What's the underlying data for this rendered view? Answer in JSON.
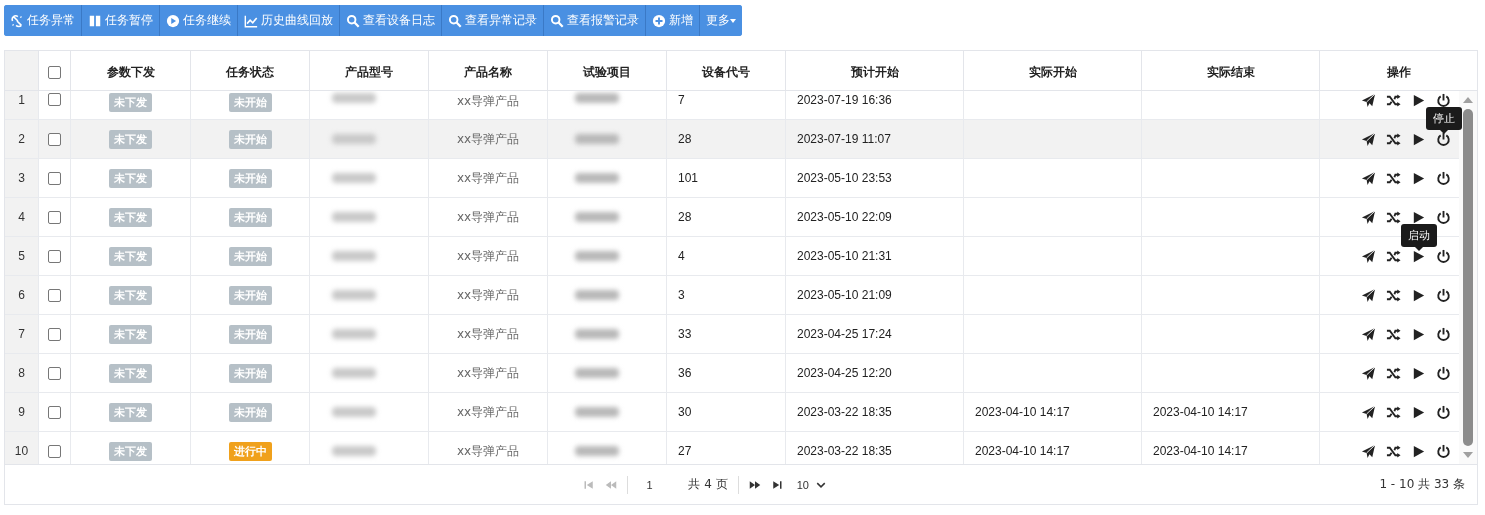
{
  "toolbar": [
    {
      "kind": "alert",
      "label": "任务异常"
    },
    {
      "kind": "pause",
      "label": "任务暂停"
    },
    {
      "kind": "play",
      "label": "任务继续"
    },
    {
      "kind": "chart",
      "label": "历史曲线回放"
    },
    {
      "kind": "search",
      "label": "查看设备日志"
    },
    {
      "kind": "search",
      "label": "查看异常记录"
    },
    {
      "kind": "search",
      "label": "查看报警记录"
    },
    {
      "kind": "add",
      "label": "新增"
    },
    {
      "kind": "more",
      "label": "更多"
    }
  ],
  "table": {
    "header_checked": false,
    "columns": [
      "参数下发",
      "任务状态",
      "产品型号",
      "产品名称",
      "试验项目",
      "设备代号",
      "预计开始",
      "实际开始",
      "实际结束",
      "操作"
    ],
    "actions": [
      {
        "kind": "send"
      },
      {
        "kind": "shuffle"
      },
      {
        "kind": "play"
      },
      {
        "kind": "power"
      }
    ],
    "rows": [
      {
        "index": "1",
        "checked": false,
        "partial": true,
        "highlighted": false,
        "dispatch": {
          "label": "未下发",
          "color": "#b6c0c7"
        },
        "status": {
          "label": "未开始",
          "color": "#b6c0c7"
        },
        "model_redacted": true,
        "name": "xx导弹产品",
        "test_redacted": true,
        "device": "7",
        "planned_start": "2023-07-19 16:36"
      },
      {
        "index": "2",
        "checked": false,
        "highlighted": true,
        "dispatch": {
          "label": "未下发",
          "color": "#b6c0c7"
        },
        "status": {
          "label": "未开始",
          "color": "#b6c0c7"
        },
        "model_redacted": true,
        "name": "xx导弹产品",
        "test_redacted": true,
        "device": "28",
        "planned_start": "2023-07-19 11:07",
        "tooltips": {
          "power": "停止"
        }
      },
      {
        "index": "3",
        "checked": false,
        "highlighted": false,
        "dispatch": {
          "label": "未下发",
          "color": "#b6c0c7"
        },
        "status": {
          "label": "未开始",
          "color": "#b6c0c7"
        },
        "model_redacted": true,
        "name": "xx导弹产品",
        "test_redacted": true,
        "device": "101",
        "planned_start": "2023-05-10 23:53"
      },
      {
        "index": "4",
        "checked": false,
        "highlighted": false,
        "dispatch": {
          "label": "未下发",
          "color": "#b6c0c7"
        },
        "status": {
          "label": "未开始",
          "color": "#b6c0c7"
        },
        "model_redacted": true,
        "name": "xx导弹产品",
        "test_redacted": true,
        "device": "28",
        "planned_start": "2023-05-10 22:09"
      },
      {
        "index": "5",
        "checked": false,
        "highlighted": false,
        "dispatch": {
          "label": "未下发",
          "color": "#b6c0c7"
        },
        "status": {
          "label": "未开始",
          "color": "#b6c0c7"
        },
        "model_redacted": true,
        "name": "xx导弹产品",
        "test_redacted": true,
        "device": "4",
        "planned_start": "2023-05-10 21:31",
        "tooltips": {
          "play": "启动"
        }
      },
      {
        "index": "6",
        "checked": false,
        "highlighted": false,
        "dispatch": {
          "label": "未下发",
          "color": "#b6c0c7"
        },
        "status": {
          "label": "未开始",
          "color": "#b6c0c7"
        },
        "model_redacted": true,
        "name": "xx导弹产品",
        "test_redacted": true,
        "device": "3",
        "planned_start": "2023-05-10 21:09"
      },
      {
        "index": "7",
        "checked": false,
        "highlighted": false,
        "dispatch": {
          "label": "未下发",
          "color": "#b6c0c7"
        },
        "status": {
          "label": "未开始",
          "color": "#b6c0c7"
        },
        "model_redacted": true,
        "name": "xx导弹产品",
        "test_redacted": true,
        "device": "33",
        "planned_start": "2023-04-25 17:24"
      },
      {
        "index": "8",
        "checked": false,
        "highlighted": false,
        "dispatch": {
          "label": "未下发",
          "color": "#b6c0c7"
        },
        "status": {
          "label": "未开始",
          "color": "#b6c0c7"
        },
        "model_redacted": true,
        "name": "xx导弹产品",
        "test_redacted": true,
        "device": "36",
        "planned_start": "2023-04-25 12:20"
      },
      {
        "index": "9",
        "checked": false,
        "highlighted": false,
        "dispatch": {
          "label": "未下发",
          "color": "#b6c0c7"
        },
        "status": {
          "label": "未开始",
          "color": "#b6c0c7"
        },
        "model_redacted": true,
        "name": "xx导弹产品",
        "test_redacted": true,
        "device": "30",
        "planned_start": "2023-03-22 18:35",
        "actual_start": "2023-04-10 14:17",
        "actual_end": "2023-04-10 14:17"
      },
      {
        "index": "10",
        "checked": false,
        "highlighted": false,
        "dispatch": {
          "label": "未下发",
          "color": "#b6c0c7"
        },
        "status": {
          "label": "进行中",
          "color": "#f0a11c"
        },
        "model_redacted": true,
        "name": "xx导弹产品",
        "test_redacted": true,
        "device": "27",
        "planned_start": "2023-03-22 18:35",
        "actual_start": "2023-04-10 14:17",
        "actual_end": "2023-04-10 14:17"
      }
    ]
  },
  "pager": {
    "first_disabled": true,
    "prev_disabled": true,
    "page": "1",
    "pages": "共 4 页",
    "next_disabled": false,
    "last_disabled": false,
    "page_size": "10",
    "summary": "1 - 10 共 33 条"
  }
}
